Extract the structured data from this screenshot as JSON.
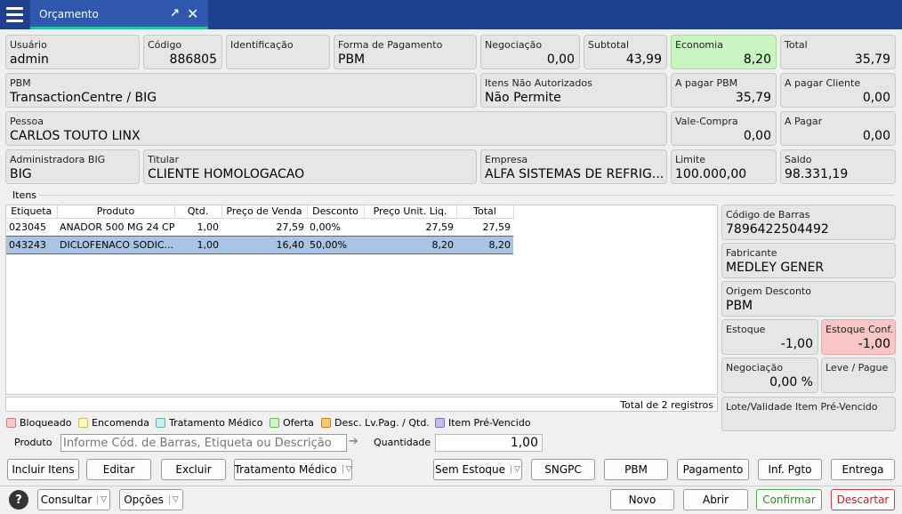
{
  "tab": {
    "title": "Orçamento"
  },
  "fields": {
    "usuario": {
      "label": "Usuário",
      "value": "admin"
    },
    "codigo": {
      "label": "Código",
      "value": "886805"
    },
    "identificacao": {
      "label": "Identificação",
      "value": ""
    },
    "forma_pagamento": {
      "label": "Forma de Pagamento",
      "value": "PBM"
    },
    "negociacao": {
      "label": "Negociação",
      "value": "0,00"
    },
    "subtotal": {
      "label": "Subtotal",
      "value": "43,99"
    },
    "economia": {
      "label": "Economia",
      "value": "8,20"
    },
    "total": {
      "label": "Total",
      "value": "35,79"
    },
    "pbm": {
      "label": "PBM",
      "value": "TransactionCentre / BIG"
    },
    "itens_nao_autorizados": {
      "label": "Itens Não Autorizados",
      "value": "Não Permite"
    },
    "a_pagar_pbm": {
      "label": "A pagar PBM",
      "value": "35,79"
    },
    "a_pagar_cliente": {
      "label": "A pagar Cliente",
      "value": "0,00"
    },
    "pessoa": {
      "label": "Pessoa",
      "value": "CARLOS TOUTO LINX"
    },
    "vale_compra": {
      "label": "Vale-Compra",
      "value": "0,00"
    },
    "a_pagar": {
      "label": "A Pagar",
      "value": "0,00"
    },
    "administradora": {
      "label": "Administradora BIG",
      "value": "BIG"
    },
    "titular": {
      "label": "Titular",
      "value": "CLIENTE HOMOLOGACAO"
    },
    "empresa": {
      "label": "Empresa",
      "value": "ALFA SISTEMAS DE REFRIG..."
    },
    "limite": {
      "label": "Limite",
      "value": "100.000,00"
    },
    "saldo": {
      "label": "Saldo",
      "value": "98.331,19"
    }
  },
  "itens_label": "Itens",
  "grid": {
    "columns": [
      "Etiqueta",
      "Produto",
      "Qtd.",
      "Preço de Venda",
      "Desconto",
      "Preço Unit. Liq.",
      "Total"
    ],
    "rows": [
      [
        "023045",
        "ANADOR 500 MG 24 CP",
        "1,00",
        "27,59",
        "0,00%",
        "27,59",
        "27,59"
      ],
      [
        "043243",
        "DICLOFENACO SODIC...",
        "1,00",
        "16,40",
        "50,00%",
        "8,20",
        "8,20"
      ]
    ],
    "footer": "Total de 2 registros"
  },
  "side": {
    "codigo_barras": {
      "label": "Código de Barras",
      "value": "7896422504492"
    },
    "fabricante": {
      "label": "Fabricante",
      "value": "MEDLEY GENER"
    },
    "origem_desconto": {
      "label": "Origem Desconto",
      "value": "PBM"
    },
    "estoque": {
      "label": "Estoque",
      "value": "-1,00"
    },
    "estoque_conf": {
      "label": "Estoque Conf.",
      "value": "-1,00"
    },
    "negociacao": {
      "label": "Negociação",
      "value": "0,00 %"
    },
    "leve_pague": {
      "label": "Leve / Pague",
      "value": ""
    },
    "lote_validade": {
      "label": "Lote/Validade Item Pré-Vencido",
      "value": ""
    }
  },
  "legend": [
    {
      "label": "Bloqueado",
      "color": "#f8c6c6",
      "border": "#d08080"
    },
    {
      "label": "Encomenda",
      "color": "#fff7c0",
      "border": "#c8b860"
    },
    {
      "label": "Tratamento Médico",
      "color": "#c8f0f0",
      "border": "#60b0b0"
    },
    {
      "label": "Oferta",
      "color": "#d0f5c8",
      "border": "#70b060"
    },
    {
      "label": "Desc. Lv.Pag. / Qtd.",
      "color": "#ffc870",
      "border": "#c08020"
    },
    {
      "label": "Item Pré-Vencido",
      "color": "#c8b8f0",
      "border": "#8070c0"
    }
  ],
  "produto": {
    "label": "Produto",
    "placeholder": "Informe Cód. de Barras, Etiqueta ou Descrição"
  },
  "quantidade": {
    "label": "Quantidade",
    "value": "1,00"
  },
  "buttons": {
    "incluir": "Incluir Itens",
    "editar": "Editar",
    "excluir": "Excluir",
    "tratamento": "Tratamento Médico",
    "sem_estoque": "Sem Estoque",
    "sngpc": "SNGPC",
    "pbm": "PBM",
    "pagamento": "Pagamento",
    "inf_pgto": "Inf. Pgto",
    "entrega": "Entrega",
    "consultar": "Consultar",
    "opcoes": "Opções",
    "novo": "Novo",
    "abrir": "Abrir",
    "confirmar": "Confirmar",
    "descartar": "Descartar"
  },
  "icons": {
    "menu": "hamburger-icon",
    "pin": "unpin-arrow-icon",
    "close": "close-icon",
    "help": "help-icon",
    "go": "arrow-right-icon",
    "dropdown": "chevron-down-icon"
  }
}
